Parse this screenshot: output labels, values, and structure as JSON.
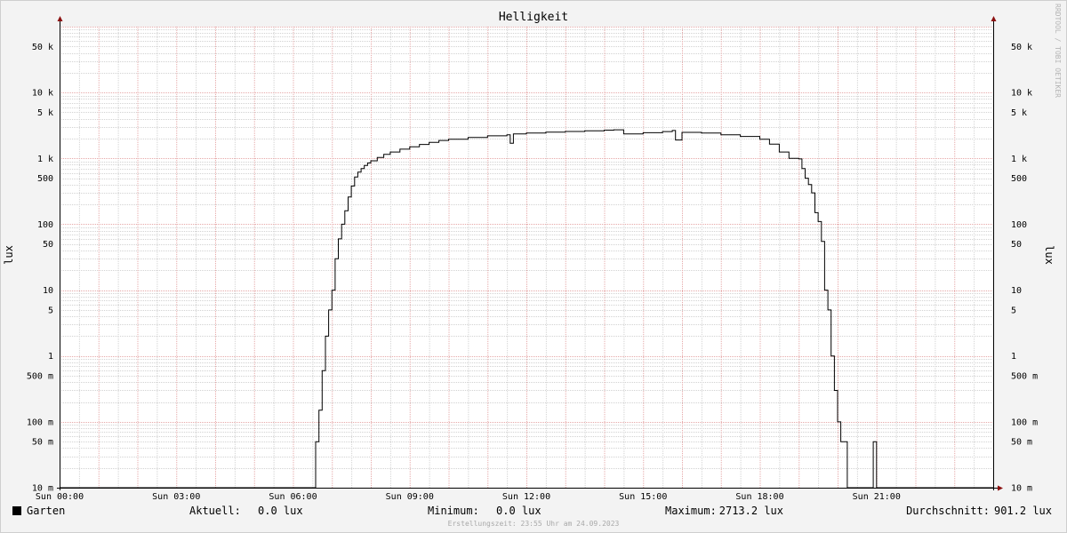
{
  "chart_data": {
    "type": "line",
    "title": "Helligkeit",
    "ylabel": "lux",
    "yscale": "log",
    "ylim": [
      0.01,
      100000
    ],
    "xlim_hours": [
      0,
      24
    ],
    "x_tick_labels": [
      "Sun 00:00",
      "Sun 03:00",
      "Sun 06:00",
      "Sun 09:00",
      "Sun 12:00",
      "Sun 15:00",
      "Sun 18:00",
      "Sun 21:00"
    ],
    "y_ticks": [
      {
        "value": 0.01,
        "label": "10 m"
      },
      {
        "value": 0.05,
        "label": "50 m"
      },
      {
        "value": 0.1,
        "label": "100 m"
      },
      {
        "value": 0.5,
        "label": "500 m"
      },
      {
        "value": 1,
        "label": "1"
      },
      {
        "value": 5,
        "label": "5"
      },
      {
        "value": 10,
        "label": "10"
      },
      {
        "value": 50,
        "label": "50"
      },
      {
        "value": 100,
        "label": "100"
      },
      {
        "value": 500,
        "label": "500"
      },
      {
        "value": 1000,
        "label": "1 k"
      },
      {
        "value": 5000,
        "label": "5 k"
      },
      {
        "value": 10000,
        "label": "10 k"
      },
      {
        "value": 50000,
        "label": "50 k"
      }
    ],
    "grid": true,
    "series": [
      {
        "name": "Garten",
        "color": "#000000",
        "x": [
          "00:00",
          "06:30",
          "06:35",
          "06:40",
          "06:45",
          "06:50",
          "06:55",
          "07:00",
          "07:05",
          "07:10",
          "07:15",
          "07:20",
          "07:25",
          "07:30",
          "07:35",
          "07:40",
          "07:45",
          "07:50",
          "07:55",
          "08:00",
          "08:10",
          "08:20",
          "08:30",
          "08:45",
          "09:00",
          "09:15",
          "09:30",
          "09:45",
          "10:00",
          "10:30",
          "11:00",
          "11:30",
          "11:35",
          "11:40",
          "12:00",
          "12:30",
          "13:00",
          "13:30",
          "14:00",
          "14:15",
          "14:30",
          "15:00",
          "15:30",
          "15:45",
          "15:50",
          "16:00",
          "16:30",
          "17:00",
          "17:30",
          "18:00",
          "18:15",
          "18:30",
          "18:45",
          "19:00",
          "19:05",
          "19:10",
          "19:15",
          "19:20",
          "19:25",
          "19:30",
          "19:35",
          "19:40",
          "19:45",
          "19:50",
          "19:55",
          "20:00",
          "20:05",
          "20:10",
          "20:15",
          "20:20",
          "20:25",
          "20:30",
          "20:40",
          "20:55",
          "21:00",
          "21:10",
          "21:25",
          "21:35",
          "22:00",
          "24:00"
        ],
        "values": [
          0.01,
          0.01,
          0.05,
          0.15,
          0.6,
          2,
          5,
          10,
          30,
          60,
          100,
          160,
          260,
          380,
          520,
          620,
          700,
          780,
          850,
          920,
          1030,
          1150,
          1250,
          1380,
          1500,
          1630,
          1750,
          1870,
          1950,
          2080,
          2200,
          2280,
          1700,
          2350,
          2420,
          2500,
          2560,
          2620,
          2680,
          2713.2,
          2350,
          2450,
          2550,
          2650,
          1900,
          2480,
          2420,
          2280,
          2150,
          1950,
          1650,
          1250,
          1000,
          980,
          700,
          500,
          400,
          300,
          150,
          110,
          55,
          10,
          5,
          1,
          0.3,
          0.1,
          0.05,
          0.05,
          0.01,
          0.01,
          0.01,
          0.01,
          0.01,
          0.05,
          0.01,
          0.01,
          0.01,
          0.01,
          0.01,
          0.01
        ]
      }
    ]
  },
  "legend": {
    "series_name": "Garten",
    "swatch_color": "#000000",
    "current_label": "Aktuell:",
    "current_value": "0.0 lux",
    "minimum_label": "Minimum:",
    "minimum_value": "0.0 lux",
    "maximum_label": "Maximum:",
    "maximum_value": "2713.2 lux",
    "average_label": "Durchschnitt:",
    "average_value": "901.2 lux"
  },
  "watermark": "RRDTOOL / TOBI OETIKER",
  "footer": "Erstellungszeit: 23:55 Uhr am 24.09.2023",
  "colors": {
    "major_grid": "#e6a8a8",
    "minor_grid": "#d2d2d2",
    "axis": "#000000",
    "arrow": "#8b1010",
    "canvas": "#ffffff",
    "background": "#f3f3f3"
  }
}
